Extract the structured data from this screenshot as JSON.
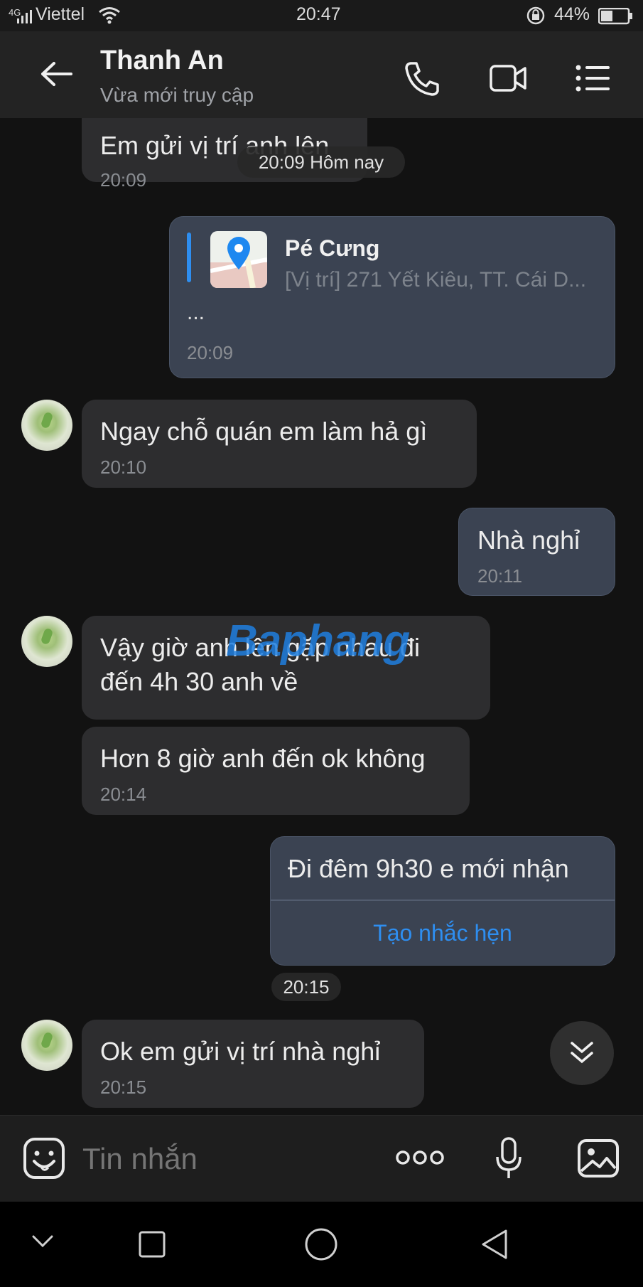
{
  "status_bar": {
    "network": "4G",
    "carrier": "Viettel",
    "time": "20:47",
    "battery": "44%"
  },
  "header": {
    "contact_name": "Thanh An",
    "presence": "Vừa mới truy cập"
  },
  "messages": {
    "m1": {
      "text": "Em gửi vị trí anh lên",
      "time": "20:09"
    },
    "date_pill": "20:09 Hôm nay",
    "location": {
      "title": "Pé Cưng",
      "address": "[Vị trí] 271 Yết Kiêu, TT. Cái D...",
      "more": "...",
      "time": "20:09"
    },
    "m3": {
      "text": "Ngay chỗ quán em làm hả gì",
      "time": "20:10"
    },
    "m4": {
      "text": "Nhà nghỉ",
      "time": "20:11"
    },
    "m5": {
      "line1": "Vậy giờ anh lên gặp nhau đi",
      "line2": "đến 4h 30 anh về"
    },
    "m6": {
      "text": "Hơn 8 giờ anh đến ok không",
      "time": "20:14"
    },
    "m7": {
      "text": "Đi đêm 9h30 e mới nhận",
      "action": "Tạo nhắc hẹn"
    },
    "time_pill": "20:15",
    "m8": {
      "text": "Ok em gửi vị trí nhà nghỉ",
      "time": "20:15"
    }
  },
  "watermark": "Baphang",
  "input": {
    "placeholder": "Tin nhắn"
  },
  "colors": {
    "accent": "#2e8ef0",
    "outgoing_bubble": "#3b4352",
    "incoming_bubble": "#2d2d2f"
  }
}
